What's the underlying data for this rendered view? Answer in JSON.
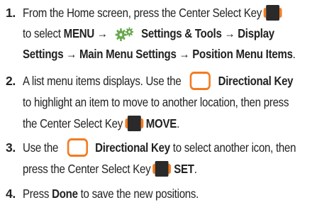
{
  "steps": [
    {
      "number": "1.",
      "lines": [
        {
          "parts": [
            "From the Home screen, press the Center Select Key"
          ]
        },
        {
          "parts": [
            "to select ",
            "MENU",
            " → ",
            " Settings & Tools → Display"
          ]
        },
        {
          "parts": [
            "Settings → Main Menu Settings → Position Menu Items",
            "."
          ]
        }
      ]
    },
    {
      "number": "2.",
      "lines": [
        {
          "parts": [
            "A list menu items displays. Use the",
            "Directional Key"
          ]
        },
        {
          "parts": [
            "to highlight an item to move to another location, then press"
          ]
        },
        {
          "parts": [
            "the Center Select Key",
            "MOVE",
            "."
          ]
        }
      ]
    },
    {
      "number": "3.",
      "lines": [
        {
          "parts": [
            "Use the",
            "Directional Key",
            " to select another icon, then"
          ]
        },
        {
          "parts": [
            "press the Center Select Key",
            "SET",
            "."
          ]
        }
      ]
    },
    {
      "number": "4.",
      "lines": [
        {
          "parts": [
            "Press ",
            "Done",
            " to save the new positions."
          ]
        }
      ]
    }
  ],
  "icons": {
    "center_select_key": "center-select-key-icon",
    "directional_key": "directional-key-icon",
    "settings_tools": "settings-tools-gear-icon"
  },
  "colors": {
    "accent_orange": "#f47b20",
    "key_dark": "#2a2a2a",
    "gear_green": "#6aa84f"
  }
}
